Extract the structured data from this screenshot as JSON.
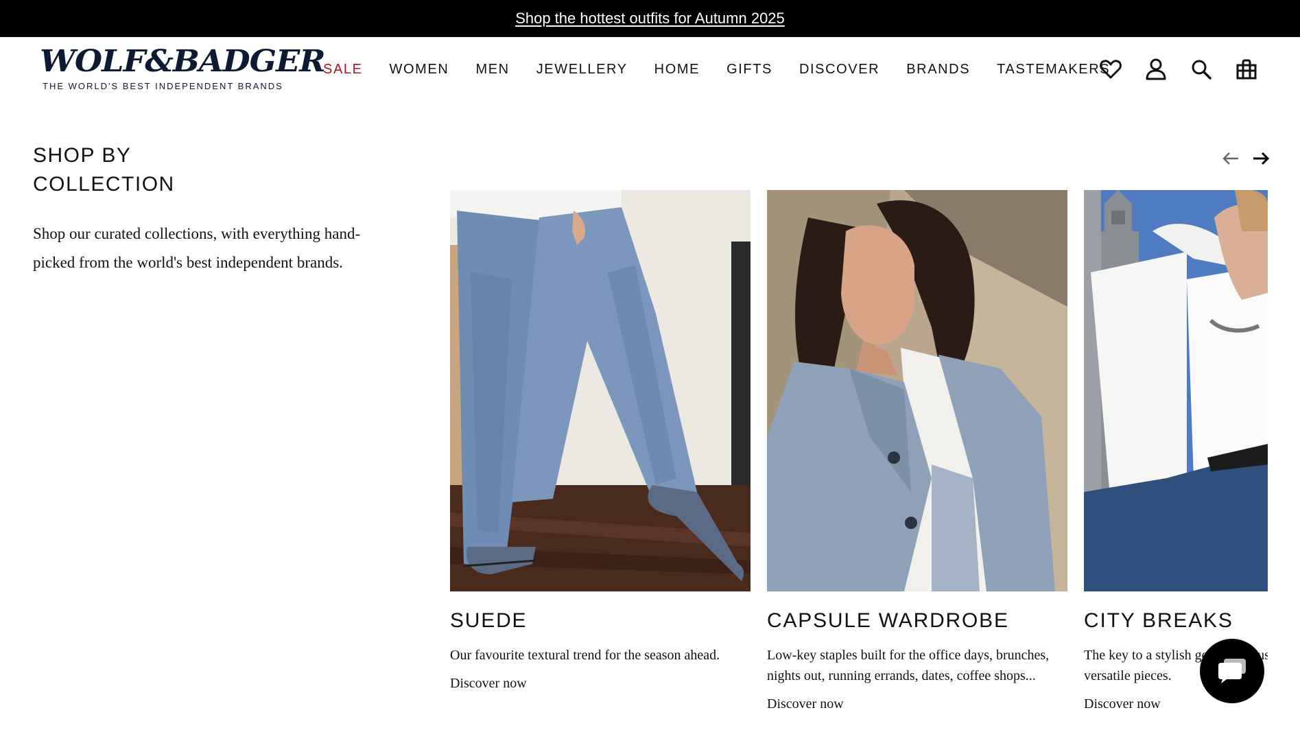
{
  "promo": {
    "text": "Shop the hottest outfits for Autumn 2025"
  },
  "logo": {
    "wordmark": "WOLF&BADGER",
    "tagline": "THE WORLD'S BEST INDEPENDENT BRANDS"
  },
  "nav": {
    "items": [
      "SALE",
      "WOMEN",
      "MEN",
      "JEWELLERY",
      "HOME",
      "GIFTS",
      "DISCOVER",
      "BRANDS",
      "TASTEMAKERS"
    ]
  },
  "header_icons": [
    "heart-icon",
    "user-icon",
    "search-icon",
    "bag-icon"
  ],
  "section": {
    "title_line1": "SHOP BY",
    "title_line2": "COLLECTION",
    "description": "Shop our curated collections, with everything hand-picked from the world's best independent brands."
  },
  "carousel": {
    "prev_icon": "arrow-left-icon",
    "next_icon": "arrow-right-icon",
    "cards": [
      {
        "title": "SUEDE",
        "description": "Our favourite textural trend for the season ahead.",
        "link": "Discover now"
      },
      {
        "title": "CAPSULE WARDROBE",
        "description": "Low-key staples built for the office days, brunches, nights out, running errands, dates, coffee shops...",
        "link": "Discover now"
      },
      {
        "title": "CITY BREAKS",
        "description": "The key to a stylish getaway? Fuss-free layering and versatile pieces.",
        "link": "Discover now"
      }
    ]
  },
  "chat": {
    "icon": "chat-icon"
  },
  "colors": {
    "sale_red": "#b20f1d",
    "logo_navy": "#0c1a33",
    "promo_bg": "#000000"
  }
}
